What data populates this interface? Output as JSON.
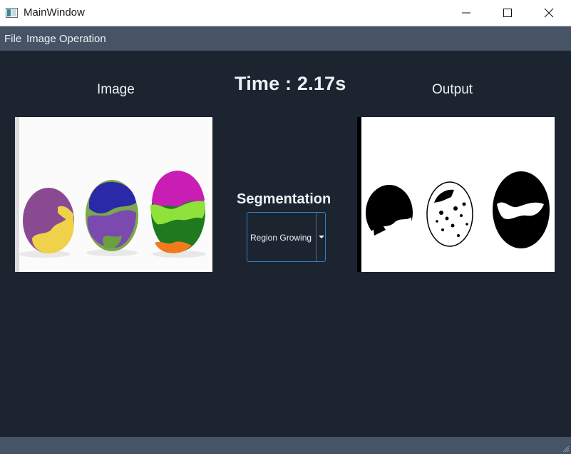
{
  "window": {
    "title": "MainWindow",
    "icon": "window-app-icon",
    "controls": [
      "minimize-icon",
      "maximize-icon",
      "close-icon"
    ]
  },
  "menubar": {
    "items": [
      "File",
      "Image Operation"
    ]
  },
  "main": {
    "image_label": "Image",
    "time_text": "Time : 2.17s",
    "output_label": "Output",
    "segmentation": {
      "label": "Segmentation",
      "selected": "Region Growing"
    }
  },
  "colors": {
    "background": "#1c2430",
    "menubar": "#465466",
    "text": "#eef1f4",
    "combo_border": "#2f82c8"
  }
}
